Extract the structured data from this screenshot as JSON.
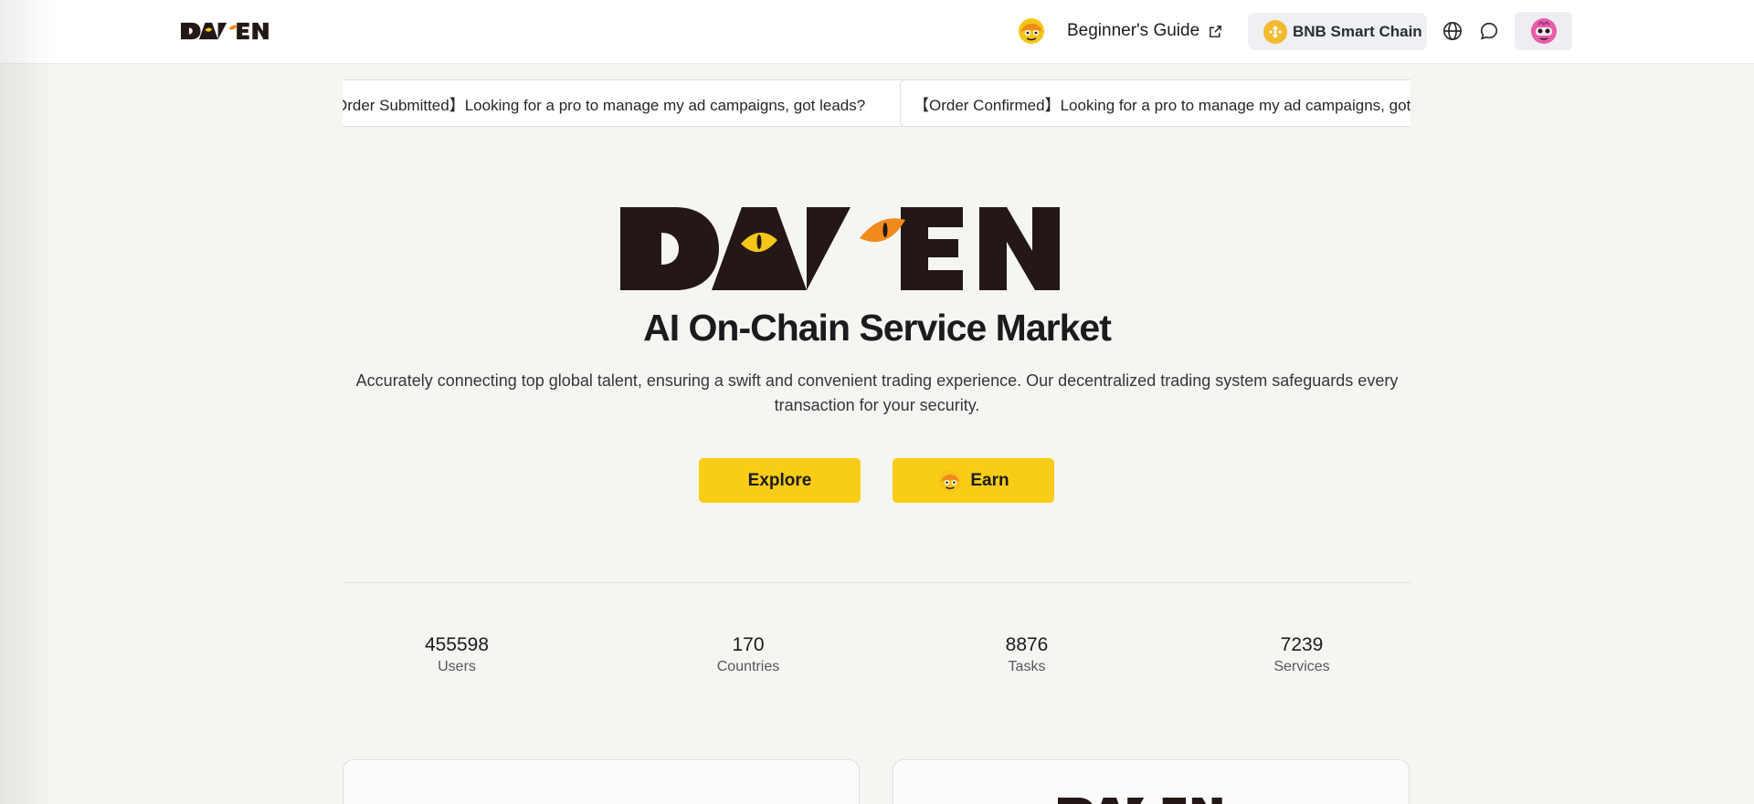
{
  "header": {
    "brand": "DAREN",
    "guide_label": "Beginner's Guide",
    "chain_label": "BNB Smart Chain",
    "icons": [
      "mascot-icon",
      "external-link-icon",
      "bnb-chain-icon",
      "globe-icon",
      "chat-icon",
      "user-avatar-icon"
    ]
  },
  "ticker": [
    "【Order Submitted】Looking for a pro to manage my ad campaigns, got leads?",
    "【Order Confirmed】Looking for a pro to manage my ad campaigns, got leads?"
  ],
  "hero": {
    "logo_text": "DAREN",
    "title": "AI On-Chain Service Market",
    "description": "Accurately connecting top global talent, ensuring a swift and convenient trading experience. Our decentralized trading system safeguards every transaction for your security.",
    "explore_label": "Explore",
    "earn_label": "Earn"
  },
  "stats": [
    {
      "value": "455598",
      "label": "Users"
    },
    {
      "value": "170",
      "label": "Countries"
    },
    {
      "value": "8876",
      "label": "Tasks"
    },
    {
      "value": "7239",
      "label": "Services"
    }
  ],
  "colors": {
    "accent_yellow": "#f9cc16",
    "eye_yellow": "#f5c518",
    "eye_orange": "#f08a1c",
    "logo_dark": "#231815",
    "page_bg": "#f5f5f2"
  }
}
